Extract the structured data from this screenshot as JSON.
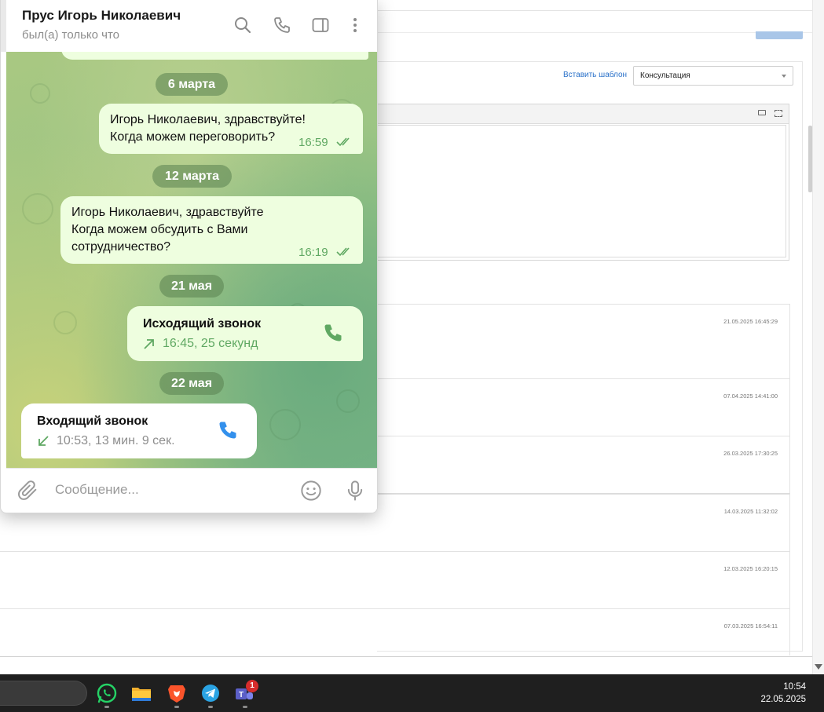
{
  "background_page": {
    "template_link": "Вставить шаблон",
    "template_select_value": "Консультация",
    "history_timestamps": [
      "21.05.2025 16:45:29",
      "07.04.2025 14:41:00",
      "26.03.2025 17:30:25",
      "14.03.2025 11:32:02",
      "12.03.2025 16:20:15",
      "07.03.2025 16:54:11"
    ]
  },
  "chat": {
    "contact_name": "Прус Игорь Николаевич",
    "status": "был(а) только что",
    "header_icons": [
      "search-icon",
      "phone-icon",
      "sidebar-panel-icon",
      "more-vertical-icon"
    ],
    "dates": [
      "6 марта",
      "12 марта",
      "21 мая",
      "22 мая"
    ],
    "messages": [
      {
        "text": "Игорь Николаевич, здравствуйте!\nКогда можем переговорить?",
        "time": "16:59"
      },
      {
        "text": "Игорь Николаевич, здравствуйте\nКогда можем обсудить с Вами\nсотрудничество?",
        "time": "16:19"
      }
    ],
    "calls": [
      {
        "title": "Исходящий звонок",
        "details": "16:45, 25 секунд"
      },
      {
        "title": "Входящий звонок",
        "details": "10:53, 13 мин. 9 сек."
      }
    ],
    "input_placeholder": "Сообщение...",
    "colors": {
      "outgoing_bubble": "#eefedf",
      "accent_green": "#5fa862",
      "call_icon_blue": "#3390ec"
    }
  },
  "taskbar": {
    "apps": [
      "whatsapp-icon",
      "file-explorer-icon",
      "brave-browser-icon",
      "telegram-icon",
      "teams-icon"
    ],
    "teams_badge": "1",
    "time": "10:54",
    "date": "22.05.2025"
  }
}
